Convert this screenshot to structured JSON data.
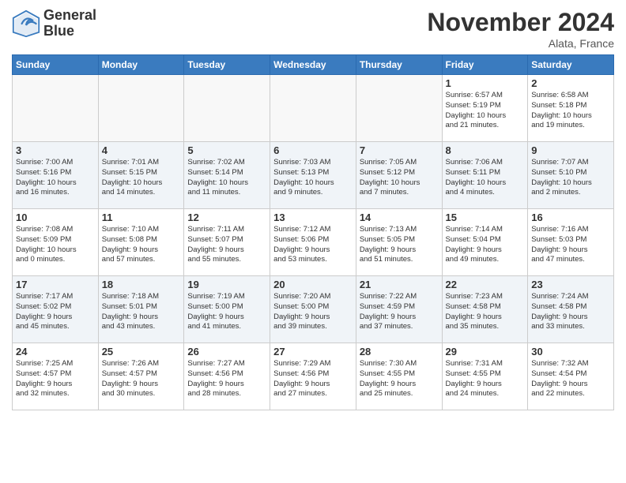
{
  "header": {
    "logo_line1": "General",
    "logo_line2": "Blue",
    "title": "November 2024",
    "location": "Alata, France"
  },
  "days_of_week": [
    "Sunday",
    "Monday",
    "Tuesday",
    "Wednesday",
    "Thursday",
    "Friday",
    "Saturday"
  ],
  "weeks": [
    [
      {
        "day": "",
        "info": ""
      },
      {
        "day": "",
        "info": ""
      },
      {
        "day": "",
        "info": ""
      },
      {
        "day": "",
        "info": ""
      },
      {
        "day": "",
        "info": ""
      },
      {
        "day": "1",
        "info": "Sunrise: 6:57 AM\nSunset: 5:19 PM\nDaylight: 10 hours\nand 21 minutes."
      },
      {
        "day": "2",
        "info": "Sunrise: 6:58 AM\nSunset: 5:18 PM\nDaylight: 10 hours\nand 19 minutes."
      }
    ],
    [
      {
        "day": "3",
        "info": "Sunrise: 7:00 AM\nSunset: 5:16 PM\nDaylight: 10 hours\nand 16 minutes."
      },
      {
        "day": "4",
        "info": "Sunrise: 7:01 AM\nSunset: 5:15 PM\nDaylight: 10 hours\nand 14 minutes."
      },
      {
        "day": "5",
        "info": "Sunrise: 7:02 AM\nSunset: 5:14 PM\nDaylight: 10 hours\nand 11 minutes."
      },
      {
        "day": "6",
        "info": "Sunrise: 7:03 AM\nSunset: 5:13 PM\nDaylight: 10 hours\nand 9 minutes."
      },
      {
        "day": "7",
        "info": "Sunrise: 7:05 AM\nSunset: 5:12 PM\nDaylight: 10 hours\nand 7 minutes."
      },
      {
        "day": "8",
        "info": "Sunrise: 7:06 AM\nSunset: 5:11 PM\nDaylight: 10 hours\nand 4 minutes."
      },
      {
        "day": "9",
        "info": "Sunrise: 7:07 AM\nSunset: 5:10 PM\nDaylight: 10 hours\nand 2 minutes."
      }
    ],
    [
      {
        "day": "10",
        "info": "Sunrise: 7:08 AM\nSunset: 5:09 PM\nDaylight: 10 hours\nand 0 minutes."
      },
      {
        "day": "11",
        "info": "Sunrise: 7:10 AM\nSunset: 5:08 PM\nDaylight: 9 hours\nand 57 minutes."
      },
      {
        "day": "12",
        "info": "Sunrise: 7:11 AM\nSunset: 5:07 PM\nDaylight: 9 hours\nand 55 minutes."
      },
      {
        "day": "13",
        "info": "Sunrise: 7:12 AM\nSunset: 5:06 PM\nDaylight: 9 hours\nand 53 minutes."
      },
      {
        "day": "14",
        "info": "Sunrise: 7:13 AM\nSunset: 5:05 PM\nDaylight: 9 hours\nand 51 minutes."
      },
      {
        "day": "15",
        "info": "Sunrise: 7:14 AM\nSunset: 5:04 PM\nDaylight: 9 hours\nand 49 minutes."
      },
      {
        "day": "16",
        "info": "Sunrise: 7:16 AM\nSunset: 5:03 PM\nDaylight: 9 hours\nand 47 minutes."
      }
    ],
    [
      {
        "day": "17",
        "info": "Sunrise: 7:17 AM\nSunset: 5:02 PM\nDaylight: 9 hours\nand 45 minutes."
      },
      {
        "day": "18",
        "info": "Sunrise: 7:18 AM\nSunset: 5:01 PM\nDaylight: 9 hours\nand 43 minutes."
      },
      {
        "day": "19",
        "info": "Sunrise: 7:19 AM\nSunset: 5:00 PM\nDaylight: 9 hours\nand 41 minutes."
      },
      {
        "day": "20",
        "info": "Sunrise: 7:20 AM\nSunset: 5:00 PM\nDaylight: 9 hours\nand 39 minutes."
      },
      {
        "day": "21",
        "info": "Sunrise: 7:22 AM\nSunset: 4:59 PM\nDaylight: 9 hours\nand 37 minutes."
      },
      {
        "day": "22",
        "info": "Sunrise: 7:23 AM\nSunset: 4:58 PM\nDaylight: 9 hours\nand 35 minutes."
      },
      {
        "day": "23",
        "info": "Sunrise: 7:24 AM\nSunset: 4:58 PM\nDaylight: 9 hours\nand 33 minutes."
      }
    ],
    [
      {
        "day": "24",
        "info": "Sunrise: 7:25 AM\nSunset: 4:57 PM\nDaylight: 9 hours\nand 32 minutes."
      },
      {
        "day": "25",
        "info": "Sunrise: 7:26 AM\nSunset: 4:57 PM\nDaylight: 9 hours\nand 30 minutes."
      },
      {
        "day": "26",
        "info": "Sunrise: 7:27 AM\nSunset: 4:56 PM\nDaylight: 9 hours\nand 28 minutes."
      },
      {
        "day": "27",
        "info": "Sunrise: 7:29 AM\nSunset: 4:56 PM\nDaylight: 9 hours\nand 27 minutes."
      },
      {
        "day": "28",
        "info": "Sunrise: 7:30 AM\nSunset: 4:55 PM\nDaylight: 9 hours\nand 25 minutes."
      },
      {
        "day": "29",
        "info": "Sunrise: 7:31 AM\nSunset: 4:55 PM\nDaylight: 9 hours\nand 24 minutes."
      },
      {
        "day": "30",
        "info": "Sunrise: 7:32 AM\nSunset: 4:54 PM\nDaylight: 9 hours\nand 22 minutes."
      }
    ]
  ]
}
